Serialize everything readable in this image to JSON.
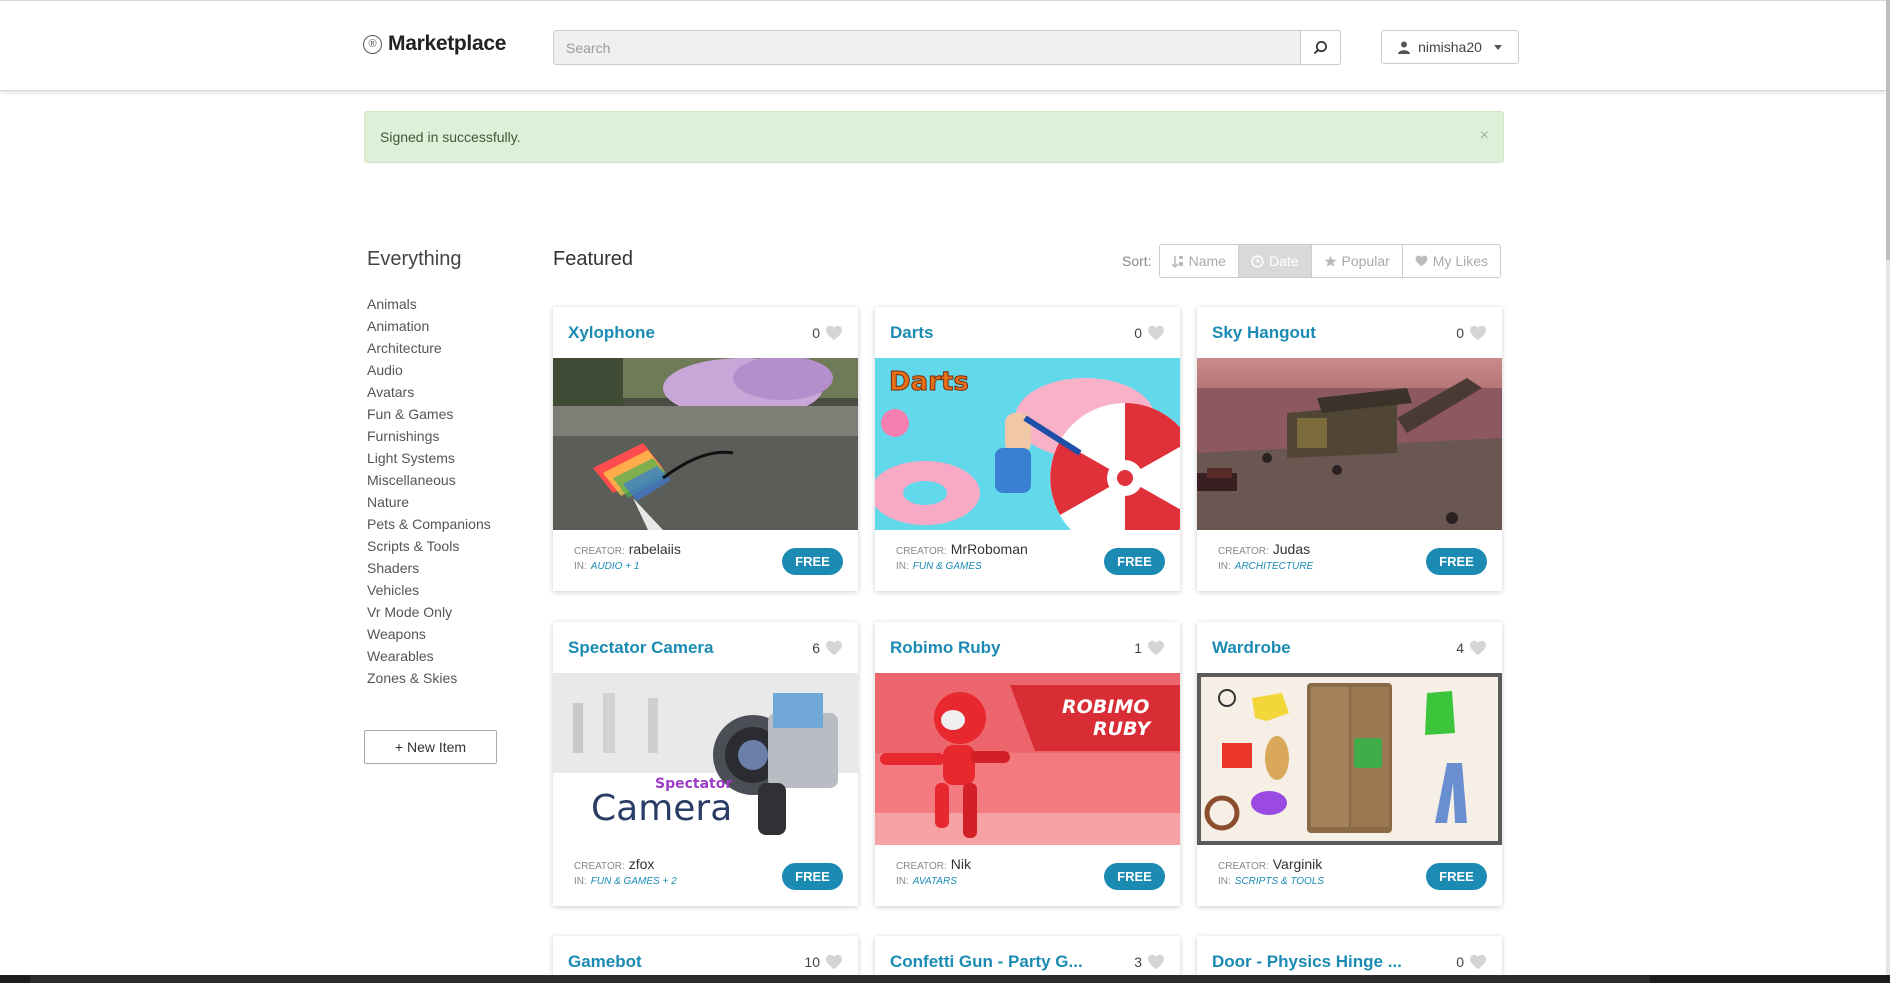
{
  "header": {
    "logo_mark": "®",
    "logo_text": "Marketplace",
    "search_placeholder": "Search",
    "search_icon": "search-icon",
    "user_name": "nimisha20",
    "user_icon": "person-icon"
  },
  "alert": {
    "message": "Signed in successfully.",
    "close": "×"
  },
  "sidebar": {
    "title": "Everything",
    "categories": [
      "Animals",
      "Animation",
      "Architecture",
      "Audio",
      "Avatars",
      "Fun & Games",
      "Furnishings",
      "Light Systems",
      "Miscellaneous",
      "Nature",
      "Pets & Companions",
      "Scripts & Tools",
      "Shaders",
      "Vehicles",
      "Vr Mode Only",
      "Weapons",
      "Wearables",
      "Zones & Skies"
    ],
    "new_item_label": "+ New Item"
  },
  "main": {
    "title": "Featured",
    "sort_label": "Sort:",
    "sort_options": [
      {
        "label": "Name",
        "icon": "sort-alpha-icon",
        "active": false
      },
      {
        "label": "Date",
        "icon": "clock-icon",
        "active": true
      },
      {
        "label": "Popular",
        "icon": "star-icon",
        "active": false
      },
      {
        "label": "My Likes",
        "icon": "heart-icon",
        "active": false
      }
    ],
    "creator_label": "CREATOR:",
    "in_label": "IN:",
    "items": [
      {
        "title": "Xylophone",
        "likes": "0",
        "creator": "rabelaiis",
        "categories": "AUDIO + 1",
        "price": "FREE"
      },
      {
        "title": "Darts",
        "likes": "0",
        "creator": "MrRoboman",
        "categories": "FUN & GAMES",
        "price": "FREE",
        "image_text": "Darts"
      },
      {
        "title": "Sky Hangout",
        "likes": "0",
        "creator": "Judas",
        "categories": "ARCHITECTURE",
        "price": "FREE"
      },
      {
        "title": "Spectator Camera",
        "likes": "6",
        "creator": "zfox",
        "categories": "FUN & GAMES + 2",
        "price": "FREE",
        "image_text_small": "Spectator",
        "image_text_large": "Camera"
      },
      {
        "title": "Robimo Ruby",
        "likes": "1",
        "creator": "Nik",
        "categories": "AVATARS",
        "price": "FREE",
        "image_text_line1": "ROBIMO",
        "image_text_line2": "RUBY"
      },
      {
        "title": "Wardrobe",
        "likes": "4",
        "creator": "Varginik",
        "categories": "SCRIPTS & TOOLS",
        "price": "FREE"
      },
      {
        "title": "Gamebot",
        "likes": "10"
      },
      {
        "title": "Confetti Gun - Party G...",
        "likes": "3"
      },
      {
        "title": "Door - Physics Hinge ...",
        "likes": "0"
      }
    ]
  }
}
